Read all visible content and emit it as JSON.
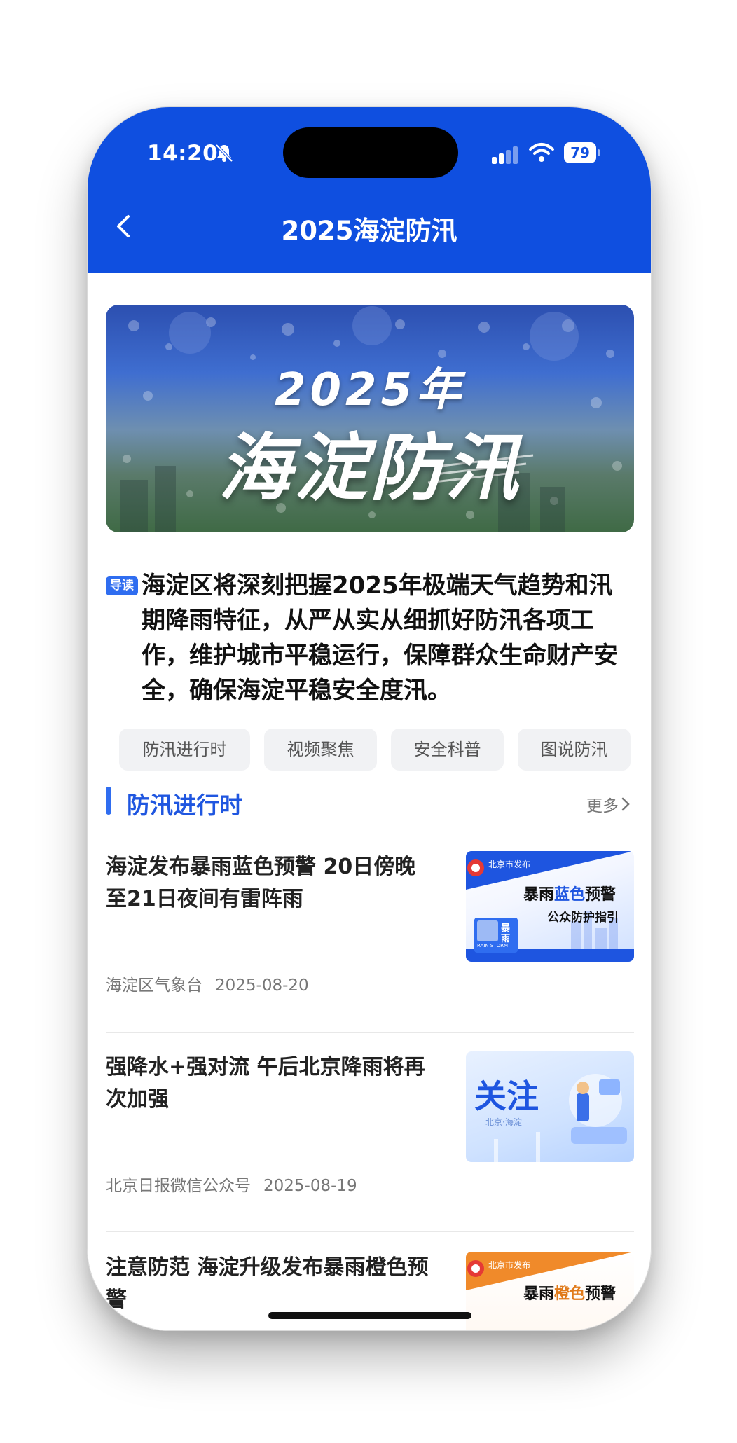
{
  "status_bar": {
    "time": "14:20",
    "battery": "79"
  },
  "nav": {
    "title": "2025海淀防汛",
    "back_icon": "chevron-left-icon"
  },
  "banner": {
    "year": "2025年",
    "title": "海淀防汛"
  },
  "intro": {
    "badge": "导读",
    "text": "海淀区将深刻把握2025年极端天气趋势和汛期降雨特征，从严从实从细抓好防汛各项工作，维护城市平稳运行，保障群众生命财产安全，确保海淀平稳安全度汛。"
  },
  "tabs": [
    "防汛进行时",
    "视频聚焦",
    "安全科普",
    "图说防汛"
  ],
  "section": {
    "title": "防汛进行时",
    "more": "更多"
  },
  "articles": [
    {
      "title": "海淀发布暴雨蓝色预警 20日傍晚至21日夜间有雷阵雨",
      "source": "海淀区气象台",
      "date": "2025-08-20",
      "thumb": {
        "publisher": "北京市发布",
        "line1a": "暴雨",
        "line1b": "蓝色",
        "line1c": "预警",
        "line2": "公众防护指引",
        "sign_top": "暴",
        "sign_bottom": "雨",
        "sign_en": "RAIN STORM"
      }
    },
    {
      "title": "强降水+强对流 午后北京降雨将再次加强",
      "source": "北京日报微信公众号",
      "date": "2025-08-19",
      "thumb": {
        "headline": "关注",
        "sub": "北京·海淀"
      }
    },
    {
      "title": "注意防范 海淀升级发布暴雨橙色预警",
      "thumb": {
        "publisher": "北京市发布",
        "line1a": "暴雨",
        "line1b": "橙色",
        "line1c": "预警"
      }
    }
  ],
  "colors": {
    "brand_blue": "#0f4fe0",
    "accent_blue": "#2f6df0",
    "warning_orange": "#e07a1a"
  }
}
